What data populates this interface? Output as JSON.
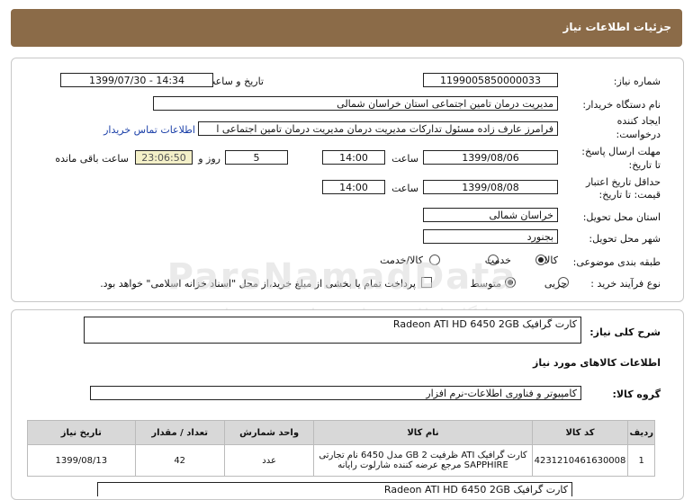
{
  "header": {
    "title": "جزئیات اطلاعات نیاز"
  },
  "form": {
    "need_number_label": "شماره نیاز:",
    "need_number": "1199005850000033",
    "announce_label": "تاریخ و ساعت اعلان عمومی:",
    "announce_value": "1399/07/30 - 14:34",
    "buyer_label": "نام دستگاه خریدار:",
    "buyer_value": "مدیریت درمان تامین اجتماعی استان خراسان شمالی",
    "requester_label_1": "ایجاد کننده",
    "requester_label_2": "درخواست:",
    "requester_value": "فرامرز عارف زاده  مسئول تدارکات مدیریت درمان مدیریت درمان تامین اجتماعی ا",
    "contact_link": "اطلاعات تماس خریدار",
    "deadline_label_1": "مهلت ارسال پاسخ:",
    "deadline_label_2": "تا تاریخ:",
    "deadline_date": "1399/08/06",
    "time_label": "ساعت",
    "deadline_time": "14:00",
    "days_value": "5",
    "days_label": "روز و",
    "remaining_time": "23:06:50",
    "remaining_label": "ساعت باقی مانده",
    "validity_label_1": "حداقل تاریخ اعتبار",
    "validity_label_2": "قیمت: تا تاریخ:",
    "validity_date": "1399/08/08",
    "validity_time": "14:00",
    "province_label": "استان محل تحویل:",
    "province_value": "خراسان شمالی",
    "city_label": "شهر محل تحویل:",
    "city_value": "بجنورد",
    "category_label": "طبقه بندی موضوعی:",
    "category_options": [
      "کالا",
      "خدمت",
      "کالا/خدمت"
    ],
    "process_label": "نوع فرآیند خرید :",
    "process_options": [
      "جزیی",
      "متوسط"
    ],
    "payment_note": "پرداخت تمام یا بخشی از مبلغ خرید،از محل \"اسناد خزانه اسلامی\" خواهد بود."
  },
  "summary": {
    "label": "شرح کلی نیاز:",
    "value": "کارت گرافیک Radeon ATI HD 6450 2GB",
    "items_heading": "اطلاعات کالاهای مورد نیاز",
    "group_label": "گروه کالا:",
    "group_value": "کامپیوتر و فناوری اطلاعات-نرم افزار"
  },
  "table": {
    "headers": [
      "ردیف",
      "کد کالا",
      "نام کالا",
      "واحد شمارش",
      "تعداد / مقدار",
      "تاریخ نیاز"
    ],
    "rows": [
      {
        "row": "1",
        "code": "4231210461630008",
        "name_line1": "کارت گرافیک ATI ظرفیت 2 GB مدل 6450 نام تجارتی",
        "name_line2": "SAPPHIRE مرجع عرضه کننده شارلوت رایانه",
        "unit": "عدد",
        "qty": "42",
        "date": "1399/08/13"
      }
    ]
  },
  "footer_partial": "کارت گرافیک Radeon ATI HD 6450 2GB",
  "watermark": {
    "line1": "ParsNamadData",
    "line2": "پایگاه اطلاع رسانی مناقصه و مزایده",
    "line3": "۰۲۱-۸۸۳۴۹۶۷۰-۵"
  }
}
